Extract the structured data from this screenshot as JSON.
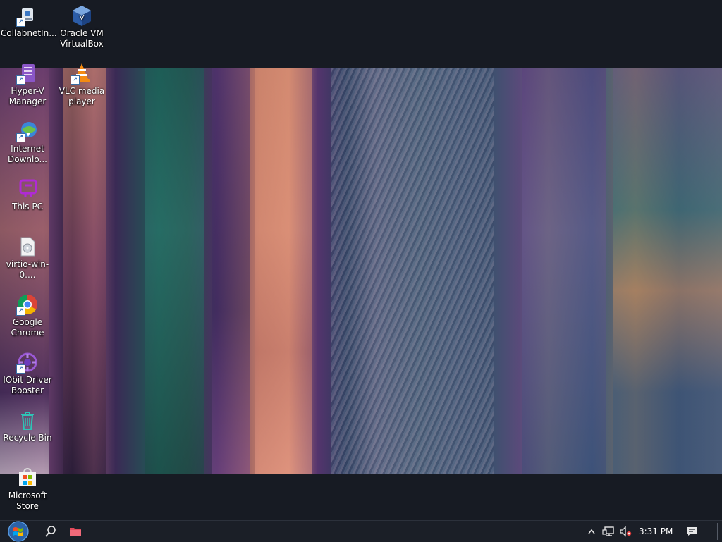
{
  "desktop": {
    "icons": [
      {
        "label": "CollabnetIn...",
        "icon": "collabnet-icon"
      },
      {
        "label": "Oracle VM VirtualBox",
        "icon": "virtualbox-icon"
      },
      {
        "label": "Hyper-V Manager",
        "icon": "hyperv-icon"
      },
      {
        "label": "VLC media player",
        "icon": "vlc-icon"
      },
      {
        "label": "Internet Downlo...",
        "icon": "internet-download-icon"
      },
      {
        "label": "This PC",
        "icon": "this-pc-icon"
      },
      {
        "label": "virtio-win-0....",
        "icon": "disc-image-icon"
      },
      {
        "label": "Google Chrome",
        "icon": "chrome-icon"
      },
      {
        "label": "IObit Driver Booster",
        "icon": "driver-booster-icon"
      },
      {
        "label": "Recycle Bin",
        "icon": "recycle-bin-icon"
      },
      {
        "label": "Microsoft Store",
        "icon": "microsoft-store-icon"
      }
    ]
  },
  "taskbar": {
    "start_icon": "windows-start-icon",
    "search_icon": "search-icon",
    "pinned_icon": "file-explorer-icon",
    "tray": {
      "chevron_icon": "show-hidden-icons-icon",
      "network_icon": "network-icon",
      "volume_icon": "volume-muted-icon",
      "time": "3:31 PM",
      "notification_icon": "action-center-icon"
    }
  },
  "colors": {
    "taskbar_bg": "#1b1f27",
    "desktop_bg": "#171b23",
    "label_text": "#ffffff"
  }
}
